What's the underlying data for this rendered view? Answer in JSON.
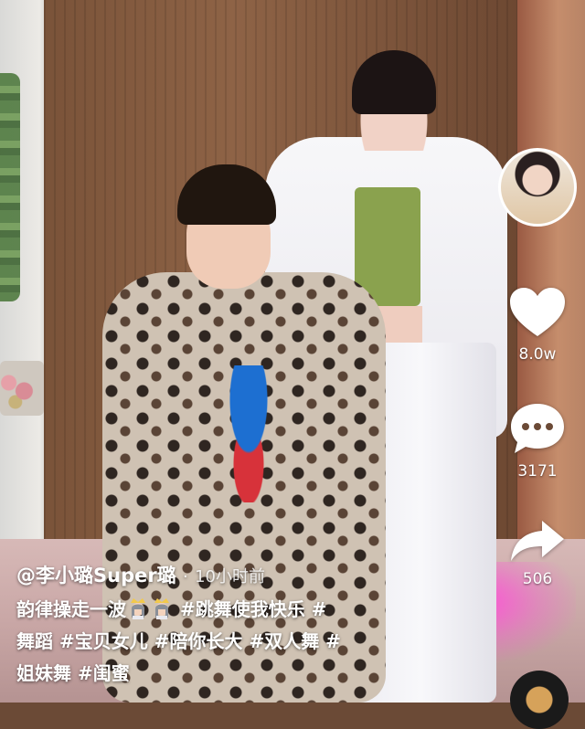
{
  "author": {
    "handle": "@李小璐Super璐",
    "time_separator": "·",
    "time": "10小时前"
  },
  "caption": {
    "segments": [
      {
        "type": "text",
        "value": "韵律操走一波"
      },
      {
        "type": "emoji",
        "value": "princess-emoji"
      },
      {
        "type": "emoji",
        "value": "princess-emoji"
      },
      {
        "type": "text",
        "value": " "
      },
      {
        "type": "tag",
        "value": "#跳舞使我快乐"
      },
      {
        "type": "text",
        "value": " "
      },
      {
        "type": "tag",
        "value": "#"
      },
      {
        "type": "br"
      },
      {
        "type": "tag",
        "value": "舞蹈"
      },
      {
        "type": "text",
        "value": " "
      },
      {
        "type": "tag",
        "value": "#宝贝女儿"
      },
      {
        "type": "text",
        "value": " "
      },
      {
        "type": "tag",
        "value": "#陪你长大"
      },
      {
        "type": "text",
        "value": " "
      },
      {
        "type": "tag",
        "value": "#双人舞"
      },
      {
        "type": "text",
        "value": " "
      },
      {
        "type": "tag",
        "value": "#"
      },
      {
        "type": "br"
      },
      {
        "type": "tag",
        "value": "姐妹舞"
      },
      {
        "type": "text",
        "value": " "
      },
      {
        "type": "tag",
        "value": "#闺蜜"
      }
    ]
  },
  "actions": {
    "likes": "8.0w",
    "comments": "3171",
    "shares": "506"
  },
  "icons": {
    "avatar": "avatar-icon",
    "like": "heart-icon",
    "comment": "comment-bubble-icon",
    "share": "share-arrow-icon",
    "music": "music-disc-icon"
  },
  "colors": {
    "overlay_text": "#ffffff",
    "pink_light": "#ff4fd8"
  }
}
